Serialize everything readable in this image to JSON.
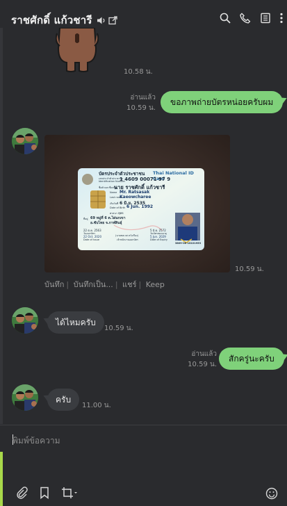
{
  "header": {
    "title": "ราชศักดิ์ แก้วชารี",
    "icons": [
      "speaker-icon",
      "external-window-icon",
      "search-icon",
      "phone-icon",
      "notes-icon",
      "more-icon"
    ]
  },
  "messages": {
    "m1": {
      "time": "10.58 น."
    },
    "m2": {
      "text": "ขอภาพถ่ายบัตรหน่อยครับผม",
      "read": "อ่านแล้ว",
      "time": "10.59 น."
    },
    "m3": {
      "time": "10.59 น.",
      "actions": [
        "บันทึก",
        "บันทึกเป็น...",
        "แชร์",
        "Keep"
      ],
      "card": {
        "title_th": "บัตรประจำตัวประชาชน",
        "title_en": "Thai National ID Card",
        "id_label": "เลขประจำตัวประชาชน",
        "id_label_en": "Identification Number",
        "id_number": "1 4609 00071 97 9",
        "name_th_label": "ชื่อตัวและชื่อสกุล",
        "name_th": "นาย ราชศักดิ์ แก้วชารี",
        "name_label": "Name",
        "name_en": "Mr. Ratsasak",
        "lastname_label": "Last name",
        "lastname_en": "Kaeowcharee",
        "dob_th_label": "เกิดวันที่",
        "dob_th": "6 มิ.ย. 2535",
        "dob_label": "Date of Birth",
        "dob_en": "6 Jun. 1992",
        "religion_label": "ศาสนา",
        "religion": "พุทธ",
        "address_label": "ที่อยู่",
        "address_1": "69 หมู่ที่ 6 ต.ไผ่นกเขา",
        "address_2": "อ.ซับไทย จ.กาฬสินธุ์",
        "issue_th": "22 ต.ค. 2563",
        "issue_en": "22 Oct. 2020",
        "issue_label_th": "วันออกบัตร",
        "issue_label_en": "Date of Issue",
        "issuer": "(นายชลเวศ หวังเรือง)",
        "issuer_title": "เจ้าพนักงานออกบัตร",
        "expiry_th": "5 มิ.ย. 2572",
        "expiry_en": "5 Jun. 2029",
        "expiry_label_th": "วันบัตรหมดอายุ",
        "expiry_label_en": "Date of Expiry",
        "serial": "3809-06-10221953"
      }
    },
    "m4": {
      "text": "ได้ไหมครับ",
      "time": "10.59 น."
    },
    "m5": {
      "text": "สักครู่นะครับ",
      "read": "อ่านแล้ว",
      "time": "10.59 น."
    },
    "m6": {
      "text": "ครับ",
      "time": "11.00 น."
    }
  },
  "composer": {
    "placeholder": "พิมพ์ข้อความ",
    "icons": [
      "attach-icon",
      "bookmark-icon",
      "crop-icon",
      "emoji-icon"
    ]
  }
}
